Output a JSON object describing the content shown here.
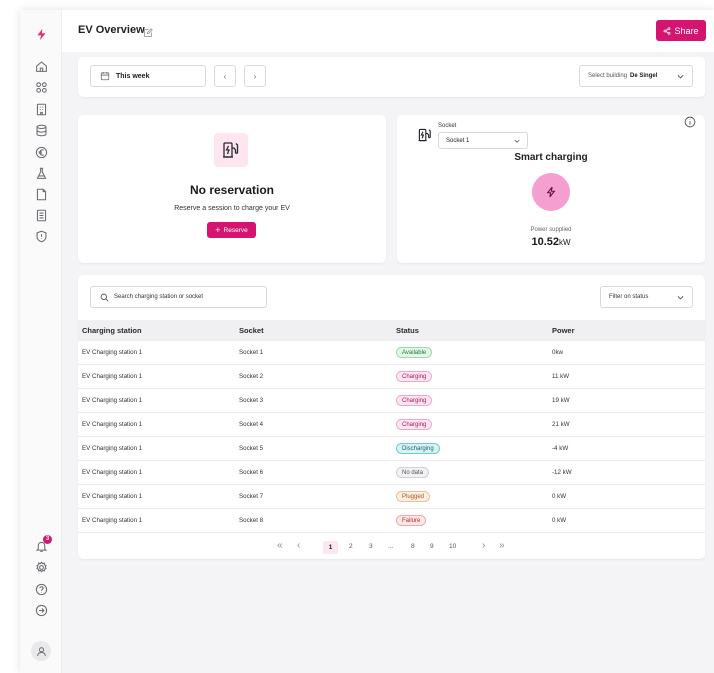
{
  "header": {
    "title": "EV Overview",
    "share_label": "Share"
  },
  "toolbar": {
    "date_range": "This week",
    "prev_label": "‹",
    "next_label": "›",
    "building_label": "Select building",
    "building_value": "De Singel"
  },
  "reservation": {
    "title": "No reservation",
    "subtitle": "Reserve a session to charge your EV",
    "button_label": "Reserve"
  },
  "charging": {
    "socket_label": "Socket",
    "socket_value": "Socket 1",
    "mode_title": "Smart charging",
    "power_label": "Power supplied",
    "power_value": "10.52",
    "power_unit": "kW"
  },
  "table": {
    "search_placeholder": "Search charging station or socket",
    "filter_label": "Filter on status",
    "columns": [
      "Charging station",
      "Socket",
      "Status",
      "Power"
    ],
    "rows": [
      {
        "station": "EV Charging station 1",
        "socket": "Socket 1",
        "status": "Available",
        "status_key": "available",
        "power": "0kw"
      },
      {
        "station": "EV Charging station 1",
        "socket": "Socket 2",
        "status": "Charging",
        "status_key": "charging",
        "power": "11 kW"
      },
      {
        "station": "EV Charging station 1",
        "socket": "Socket 3",
        "status": "Charging",
        "status_key": "charging",
        "power": "19 kW"
      },
      {
        "station": "EV Charging station 1",
        "socket": "Socket 4",
        "status": "Charging",
        "status_key": "charging",
        "power": "21 kW"
      },
      {
        "station": "EV Charging station 1",
        "socket": "Socket 5",
        "status": "Discharging",
        "status_key": "discharging",
        "power": "-4 kW"
      },
      {
        "station": "EV Charging station 1",
        "socket": "Socket 6",
        "status": "No data",
        "status_key": "nodata",
        "power": "-12 kW"
      },
      {
        "station": "EV Charging station 1",
        "socket": "Socket 7",
        "status": "Plugged",
        "status_key": "plugged",
        "power": "0 kW"
      },
      {
        "station": "EV Charging station 1",
        "socket": "Socket 8",
        "status": "Failure",
        "status_key": "failure",
        "power": "0 kW"
      }
    ]
  },
  "pagination": {
    "first": "«",
    "prev": "‹",
    "pages": [
      "1",
      "2",
      "3",
      "...",
      "8",
      "9",
      "10"
    ],
    "current": "1",
    "next": "›",
    "last": "»"
  },
  "sidebar": {
    "icons": [
      "logo-bolt-icon",
      "home-icon",
      "grid-icon",
      "building-icon",
      "database-icon",
      "euro-icon",
      "flask-icon",
      "document-icon",
      "report-icon",
      "shield-icon"
    ],
    "notification_count": "3",
    "bottom_icons": [
      "bell-icon",
      "gear-icon",
      "help-icon",
      "logout-icon",
      "user-avatar-icon"
    ]
  },
  "colors": {
    "accent": "#d4156f",
    "accent_light": "#fde6f0",
    "bolt_circle": "#f59ed0",
    "background": "#f4f4f6"
  }
}
